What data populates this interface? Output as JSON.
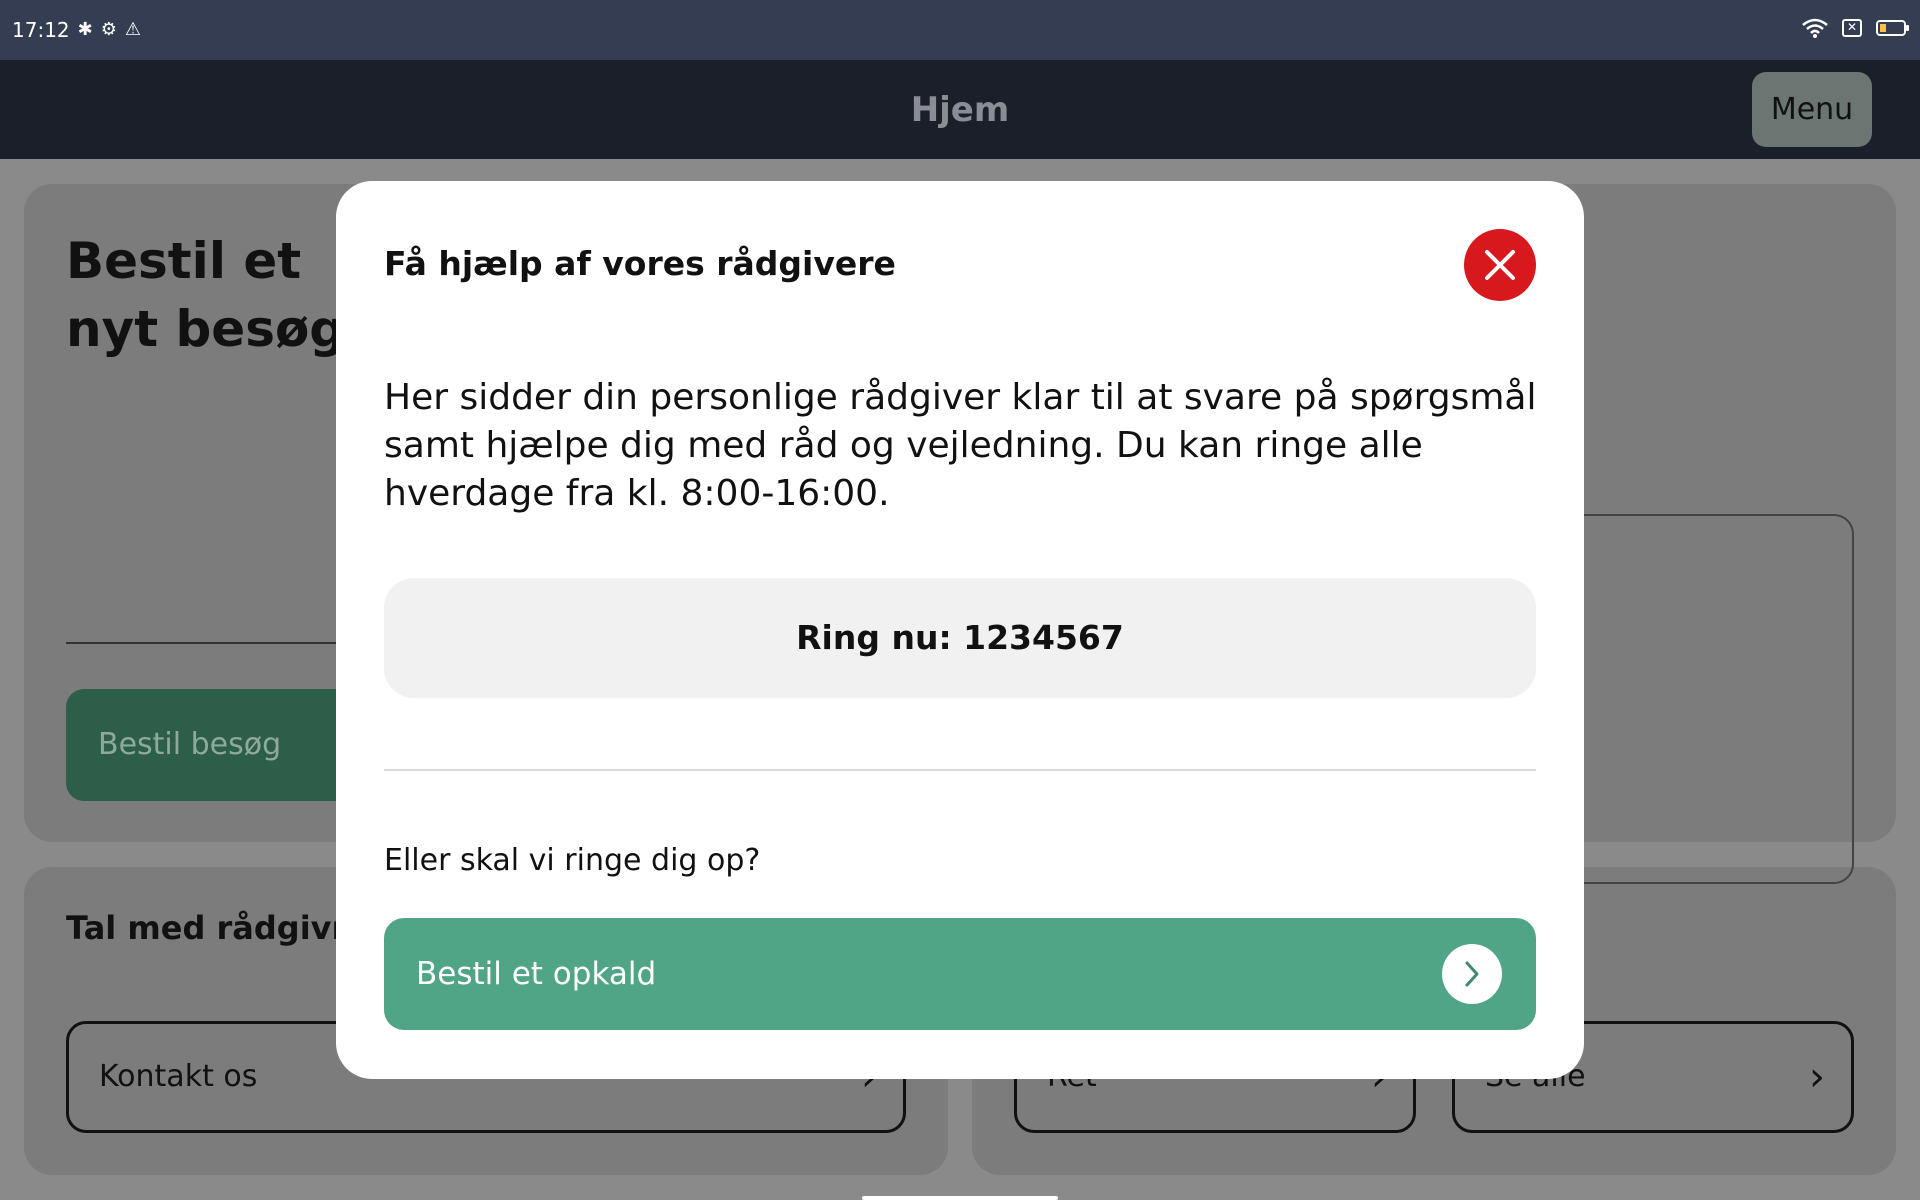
{
  "status_bar": {
    "time": "17:12",
    "left_icons": [
      "bluetooth-icon",
      "settings-icon",
      "warning-icon"
    ],
    "right_icons": [
      "wifi-icon",
      "no-sim-icon",
      "battery-icon"
    ]
  },
  "header": {
    "title": "Hjem",
    "menu_label": "Menu"
  },
  "background": {
    "visit_card_title": "Bestil et nyt besøg",
    "visit_button_label": "Bestil besøg",
    "talk_title": "Tal med rådgivnin",
    "contact_label": "Kontakt os",
    "ret_label": "Ret",
    "see_all_label": "Se alle"
  },
  "modal": {
    "title": "Få hjælp af vores rådgivere",
    "body": "Her sidder din personlige rådgiver klar til at svare på spørgsmål samt hjælpe dig med råd og vejledning. Du kan ringe alle hverdage fra kl. 8:00-16:00.",
    "call_now_label": "Ring nu: 1234567",
    "callback_question": "Eller skal vi ringe dig op?",
    "order_call_label": "Bestil et opkald"
  },
  "colors": {
    "status_bar": "#343d52",
    "app_bar": "#1b1f29",
    "close_button": "#d7191d",
    "primary_green": "#50a587"
  }
}
